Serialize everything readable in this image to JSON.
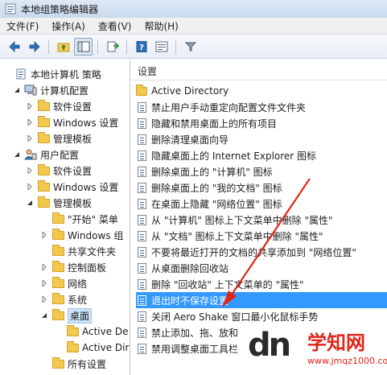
{
  "window": {
    "title": "本地组策略编辑器"
  },
  "menu": [
    {
      "id": "file",
      "label": "文件(F)"
    },
    {
      "id": "action",
      "label": "操作(A)"
    },
    {
      "id": "view",
      "label": "查看(V)"
    },
    {
      "id": "help",
      "label": "帮助(H)"
    }
  ],
  "toolbar": [
    "back-icon",
    "forward-icon",
    "up-folder-icon",
    "show-hide-tree-icon",
    "export-list-icon",
    "help-icon",
    "properties-icon",
    "filter-icon"
  ],
  "tree": [
    {
      "label": "本地计算机 策略",
      "level": 0,
      "expander": "none",
      "icon": "computer-policy-icon"
    },
    {
      "label": "计算机配置",
      "level": 1,
      "expander": "open",
      "icon": "computer-icon"
    },
    {
      "label": "软件设置",
      "level": 2,
      "expander": "closed",
      "icon": "folder-icon"
    },
    {
      "label": "Windows 设置",
      "level": 2,
      "expander": "closed",
      "icon": "folder-icon"
    },
    {
      "label": "管理模板",
      "level": 2,
      "expander": "closed",
      "icon": "folder-icon"
    },
    {
      "label": "用户配置",
      "level": 1,
      "expander": "open",
      "icon": "user-icon"
    },
    {
      "label": "软件设置",
      "level": 2,
      "expander": "closed",
      "icon": "folder-icon"
    },
    {
      "label": "Windows 设置",
      "level": 2,
      "expander": "closed",
      "icon": "folder-icon"
    },
    {
      "label": "管理模板",
      "level": 2,
      "expander": "open",
      "icon": "folder-icon"
    },
    {
      "label": "\"开始\" 菜单",
      "level": 3,
      "expander": "none",
      "icon": "folder-icon"
    },
    {
      "label": "Windows 组",
      "level": 3,
      "expander": "closed",
      "icon": "folder-icon"
    },
    {
      "label": "共享文件夹",
      "level": 3,
      "expander": "none",
      "icon": "folder-icon"
    },
    {
      "label": "控制面板",
      "level": 3,
      "expander": "closed",
      "icon": "folder-icon"
    },
    {
      "label": "网络",
      "level": 3,
      "expander": "closed",
      "icon": "folder-icon"
    },
    {
      "label": "系统",
      "level": 3,
      "expander": "closed",
      "icon": "folder-icon"
    },
    {
      "label": "桌面",
      "level": 3,
      "expander": "open",
      "icon": "folder-icon",
      "selected": true
    },
    {
      "label": "Active De",
      "level": 4,
      "expander": "none",
      "icon": "folder-icon"
    },
    {
      "label": "Active Dir",
      "level": 4,
      "expander": "none",
      "icon": "folder-icon"
    },
    {
      "label": "所有设置",
      "level": 3,
      "expander": "none",
      "icon": "folder-icon"
    }
  ],
  "list": {
    "header": "设置",
    "rows": [
      {
        "label": "Active Directory",
        "icon": "folder-icon"
      },
      {
        "label": "禁止用户手动重定向配置文件文件夹",
        "icon": "policy-icon"
      },
      {
        "label": "隐藏和禁用桌面上的所有项目",
        "icon": "policy-icon"
      },
      {
        "label": "删除清理桌面向导",
        "icon": "policy-icon"
      },
      {
        "label": "隐藏桌面上的 Internet Explorer 图标",
        "icon": "policy-icon"
      },
      {
        "label": "删除桌面上的 \"计算机\" 图标",
        "icon": "policy-icon"
      },
      {
        "label": "删除桌面上的 \"我的文档\" 图标",
        "icon": "policy-icon"
      },
      {
        "label": "在桌面上隐藏 \"网络位置\" 图标",
        "icon": "policy-icon"
      },
      {
        "label": "从 \"计算机\" 图标上下文菜单中删除 \"属性\"",
        "icon": "policy-icon"
      },
      {
        "label": "从 \"文档\" 图标上下文菜单中删除 \"属性\"",
        "icon": "policy-icon"
      },
      {
        "label": "不要将最近打开的文档的共享添加到 \"网络位置\"",
        "icon": "policy-icon"
      },
      {
        "label": "从桌面删除回收站",
        "icon": "policy-icon"
      },
      {
        "label": "删除 \"回收站\" 上下文菜单的 \"属性\"",
        "icon": "policy-icon"
      },
      {
        "label": "退出时不保存设置",
        "icon": "policy-icon",
        "selected": true
      },
      {
        "label": "关闭 Aero Shake 窗口最小化鼠标手势",
        "icon": "policy-icon"
      },
      {
        "label": "禁止添加、拖、放和",
        "icon": "policy-icon"
      },
      {
        "label": "禁用调整桌面工具栏",
        "icon": "policy-icon"
      }
    ]
  },
  "watermark": {
    "logo": "dn",
    "title": "学知网",
    "url": "www.jmqz1000.com"
  },
  "colors": {
    "selection": "#3399ff",
    "arrow": "#e0251b"
  }
}
